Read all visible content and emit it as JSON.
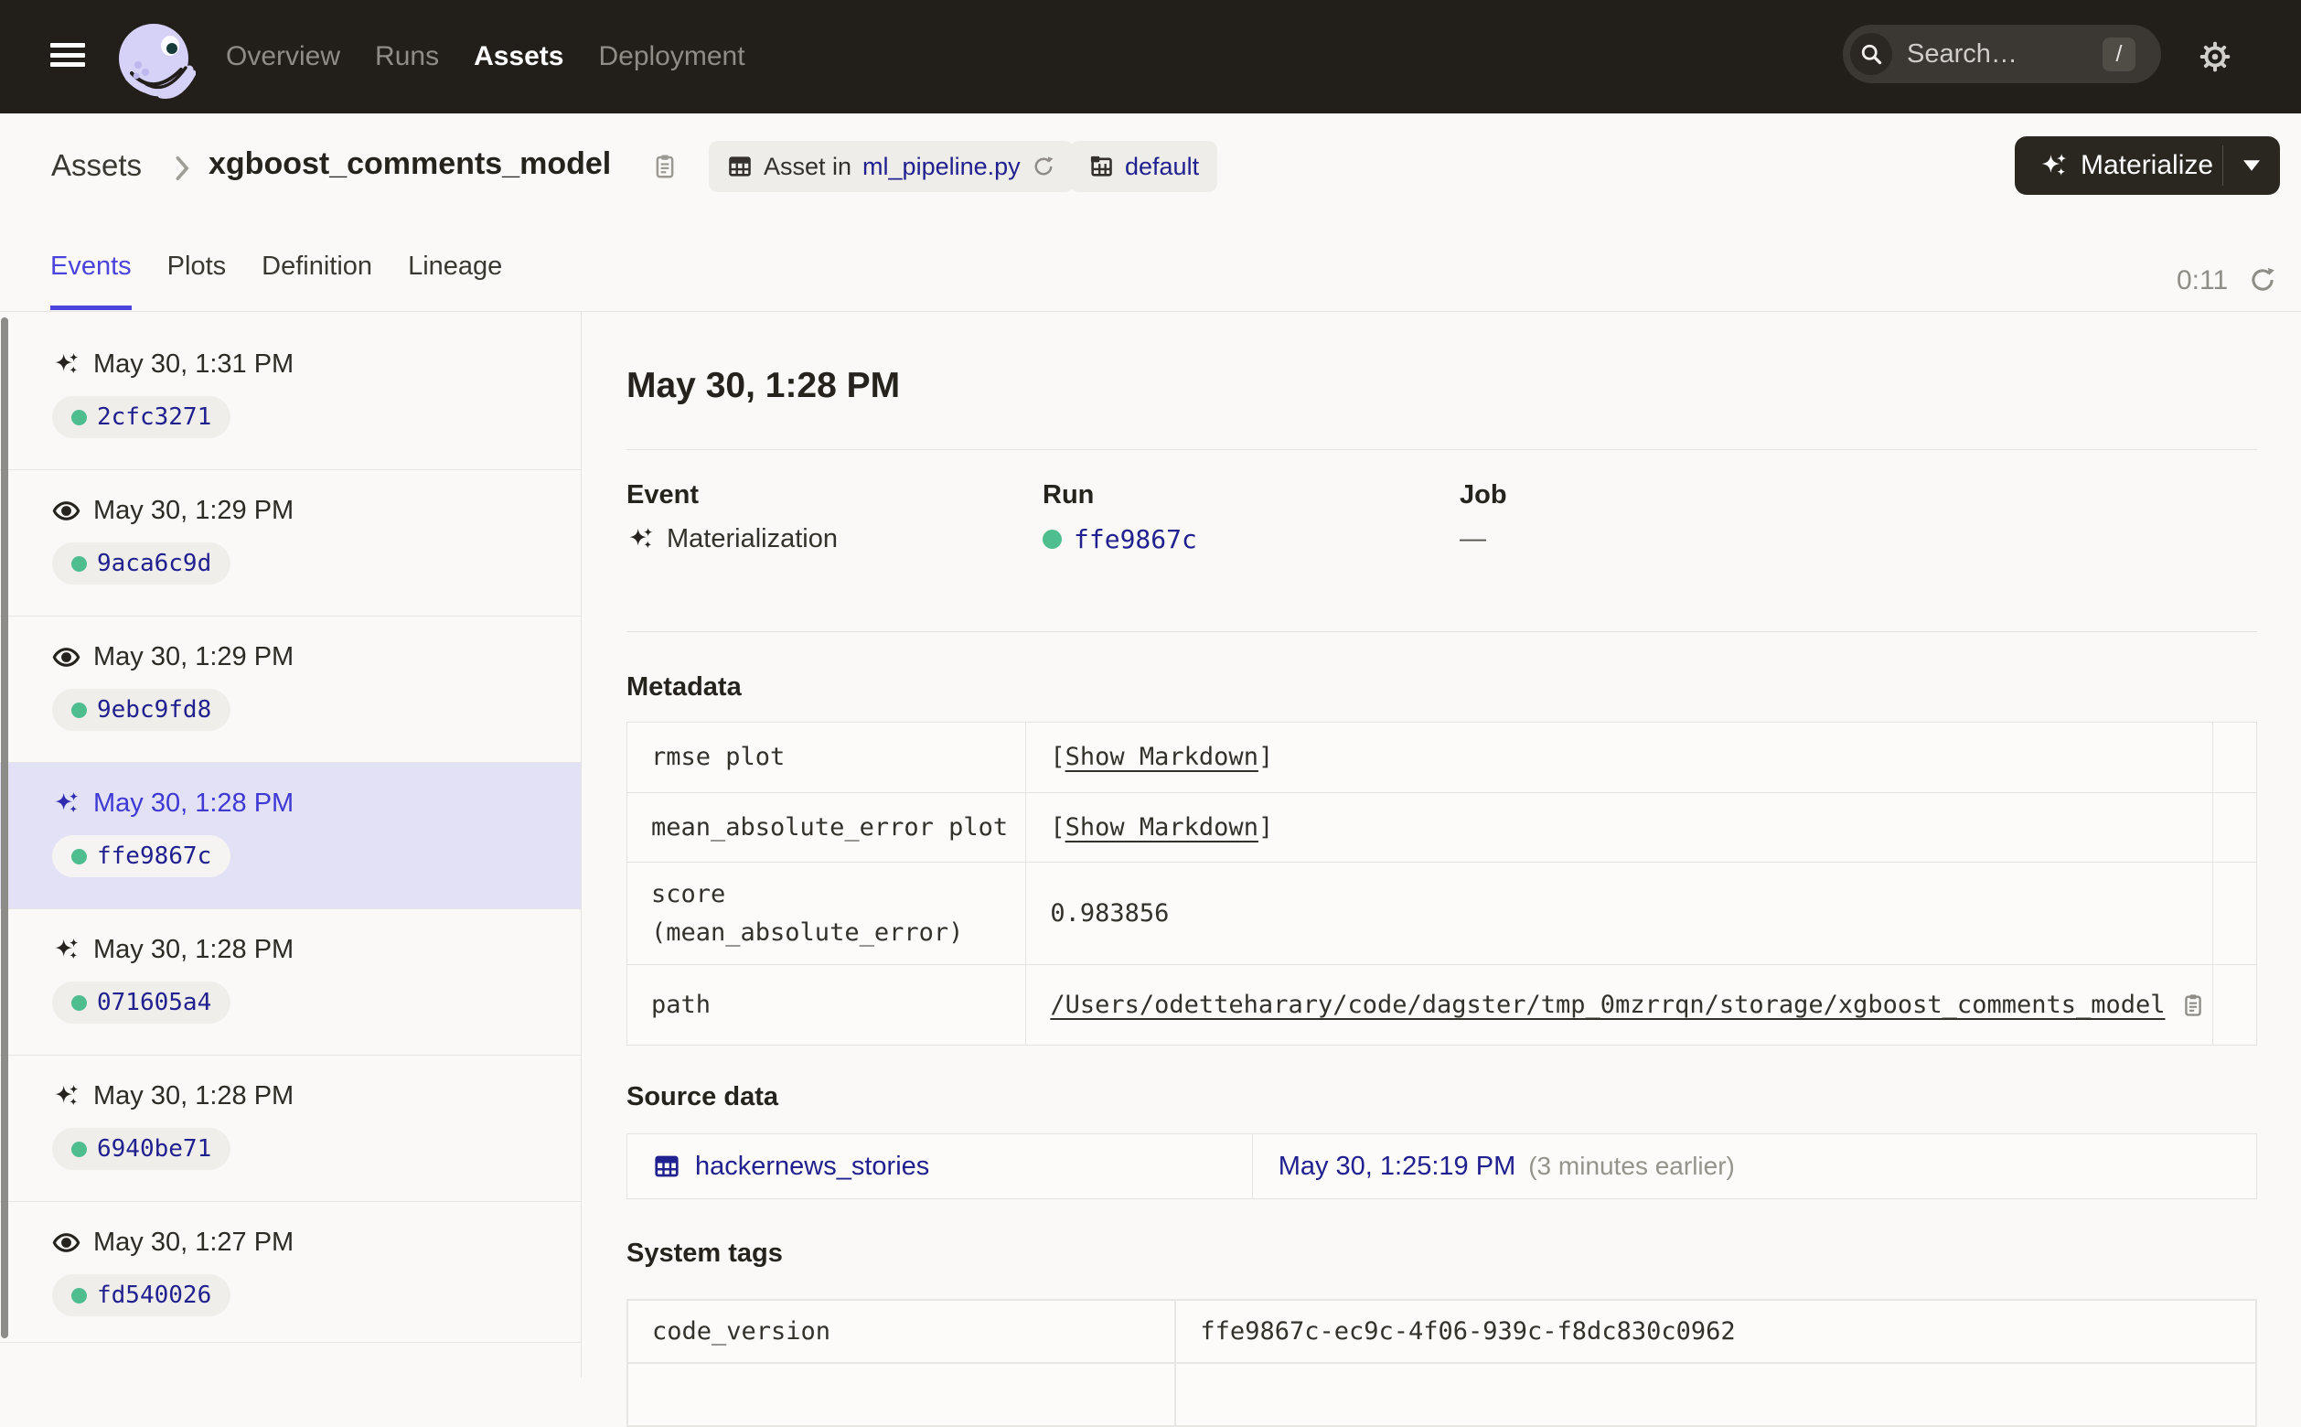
{
  "colors": {
    "accent": "#4A43DC",
    "link_navy": "#21208F",
    "success_green": "#4FBE8E",
    "nav_background": "#221F1B",
    "selected_row_background": "#E3E1F6"
  },
  "nav": {
    "items": [
      {
        "label": "Overview"
      },
      {
        "label": "Runs"
      },
      {
        "label": "Assets"
      },
      {
        "label": "Deployment"
      }
    ],
    "search_placeholder": "Search…",
    "search_shortcut": "/"
  },
  "breadcrumb": {
    "root": "Assets",
    "title": "xgboost_comments_model"
  },
  "header_badges": {
    "asset_in_prefix": "Asset in",
    "asset_in_link": "ml_pipeline.py",
    "repo_label": "default"
  },
  "materialize": {
    "label": "Materialize"
  },
  "tabs": [
    {
      "label": "Events"
    },
    {
      "label": "Plots"
    },
    {
      "label": "Definition"
    },
    {
      "label": "Lineage"
    }
  ],
  "auto_refresh": {
    "timer": "0:11"
  },
  "sidebar": {
    "items": [
      {
        "type": "materialization",
        "time": "May 30, 1:31 PM",
        "run_id": "2cfc3271"
      },
      {
        "type": "observation",
        "time": "May 30, 1:29 PM",
        "run_id": "9aca6c9d"
      },
      {
        "type": "observation",
        "time": "May 30, 1:29 PM",
        "run_id": "9ebc9fd8"
      },
      {
        "type": "materialization",
        "time": "May 30, 1:28 PM",
        "run_id": "ffe9867c",
        "selected": true
      },
      {
        "type": "materialization",
        "time": "May 30, 1:28 PM",
        "run_id": "071605a4"
      },
      {
        "type": "materialization",
        "time": "May 30, 1:28 PM",
        "run_id": "6940be71"
      },
      {
        "type": "observation",
        "time": "May 30, 1:27 PM",
        "run_id": "fd540026"
      }
    ]
  },
  "detail": {
    "heading": "May 30, 1:28 PM",
    "event_label": "Event",
    "event_value": "Materialization",
    "run_label": "Run",
    "run_value": "ffe9867c",
    "job_label": "Job",
    "job_value": "—",
    "metadata_heading": "Metadata",
    "metadata_rows": [
      {
        "key": "rmse plot",
        "bracket_open": "[",
        "link": "Show Markdown",
        "bracket_close": "]"
      },
      {
        "key": "mean_absolute_error plot",
        "bracket_open": "[",
        "link": "Show Markdown",
        "bracket_close": "]"
      },
      {
        "key": "score (mean_absolute_error)",
        "value": "0.983856"
      },
      {
        "key": "path",
        "link": "/Users/odetteharary/code/dagster/tmp_0mzrrqn/storage/xgboost_comments_model"
      }
    ],
    "source_heading": "Source data",
    "source": {
      "asset": "hackernews_stories",
      "time_link": "May 30, 1:25:19 PM",
      "time_note": "(3 minutes earlier)"
    },
    "system_heading": "System tags",
    "system_rows": [
      {
        "key": "code_version",
        "value": "ffe9867c-ec9c-4f06-939c-f8dc830c0962"
      }
    ]
  }
}
